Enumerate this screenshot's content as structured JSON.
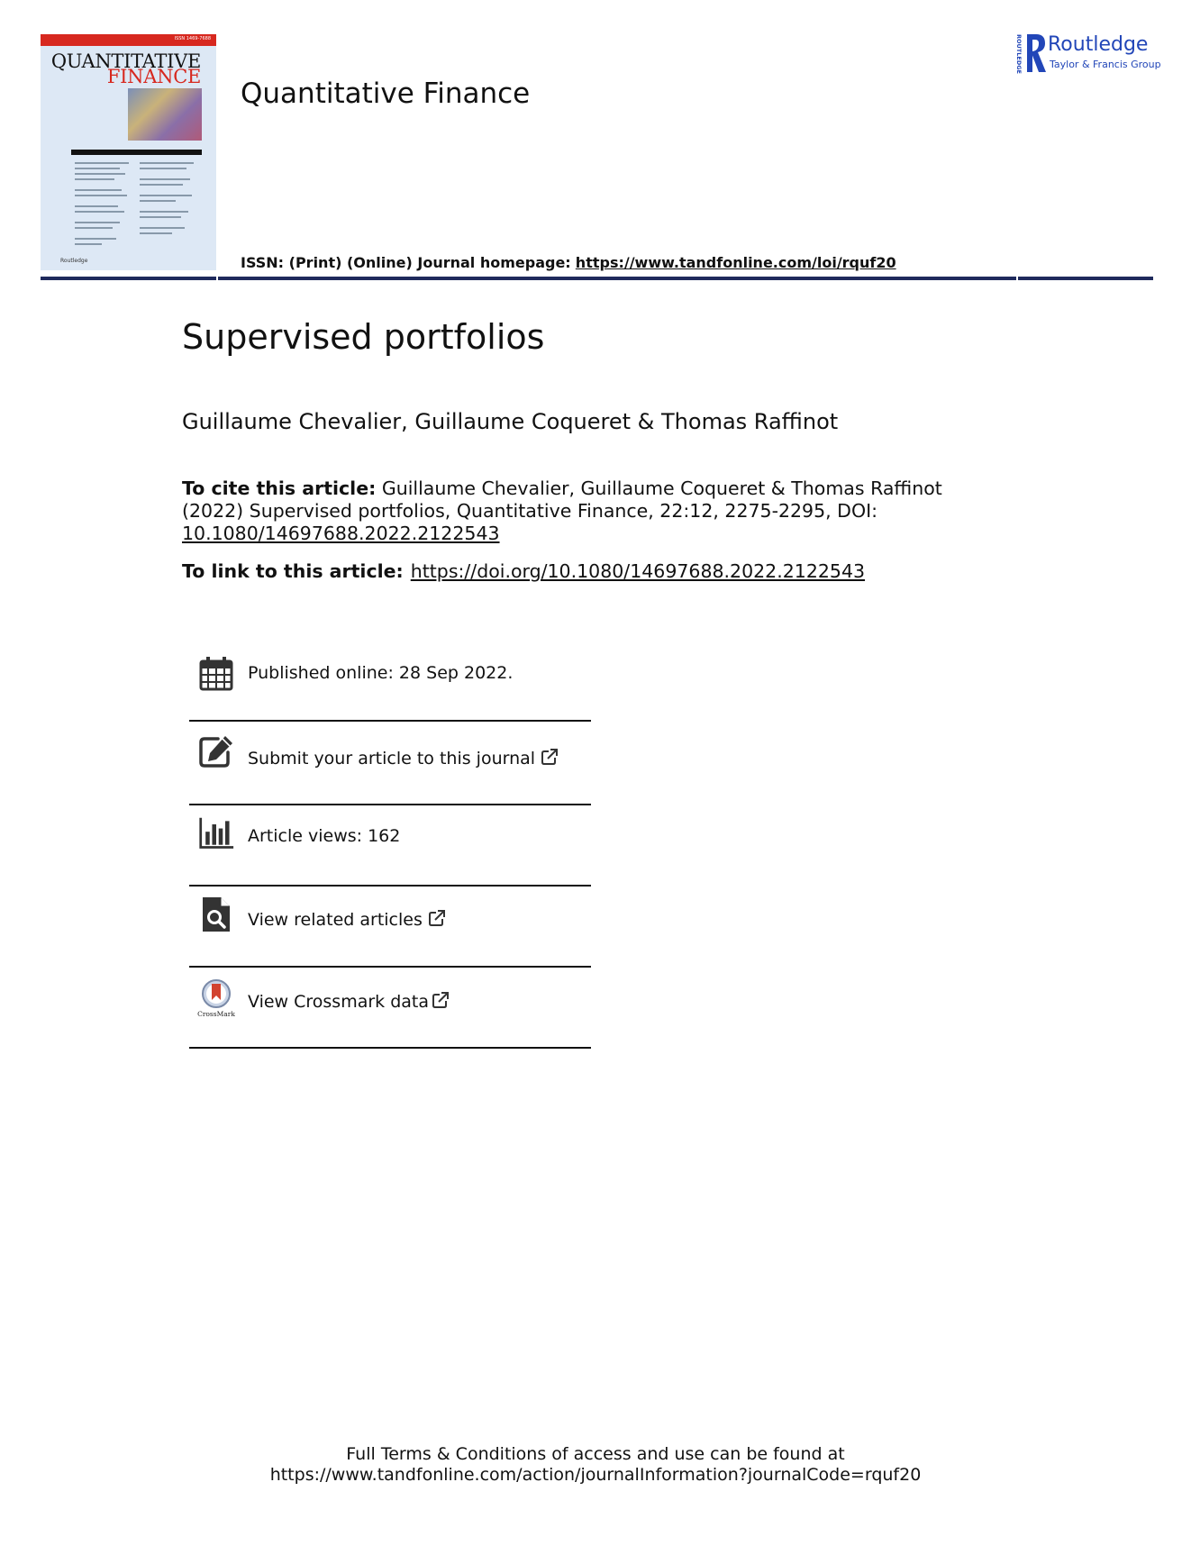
{
  "cover": {
    "issn": "ISSN 1469-7688",
    "line1": "QUANTITATIVE",
    "line2": "FINANCE",
    "publisher": "Routledge"
  },
  "journal_title": "Quantitative Finance",
  "logo": {
    "name": "Routledge",
    "subtitle": "Taylor & Francis Group",
    "side_text": "ROUTLEDGE"
  },
  "issn_line": {
    "prefix": "ISSN: (Print) (Online) Journal homepage:",
    "url": "https://www.tandfonline.com/loi/rquf20"
  },
  "article": {
    "title": "Supervised portfolios",
    "authors": "Guillaume Chevalier, Guillaume Coqueret & Thomas Raffinot"
  },
  "citation": {
    "label": "To cite this article:",
    "text": "Guillaume Chevalier, Guillaume Coqueret & Thomas Raffinot (2022) Supervised portfolios, Quantitative Finance, 22:12, 2275-2295, DOI:",
    "doi": "10.1080/14697688.2022.2122543"
  },
  "link": {
    "label": "To link to this article:",
    "url": "https://doi.org/10.1080/14697688.2022.2122543"
  },
  "info": {
    "published": "Published online: 28 Sep 2022.",
    "submit": "Submit your article to this journal",
    "views": "Article views: 162",
    "related": "View related articles",
    "crossmark": "View Crossmark data",
    "crossmark_logo_text": "CrossMark"
  },
  "footer": {
    "line1": "Full Terms & Conditions of access and use can be found at",
    "line2": "https://www.tandfonline.com/action/journalInformation?journalCode=rquf20"
  },
  "colors": {
    "routledge_blue": "#2246b8",
    "header_rule": "#1f2a5c",
    "cover_red": "#d7281f",
    "cover_bg": "#dde8f5"
  }
}
